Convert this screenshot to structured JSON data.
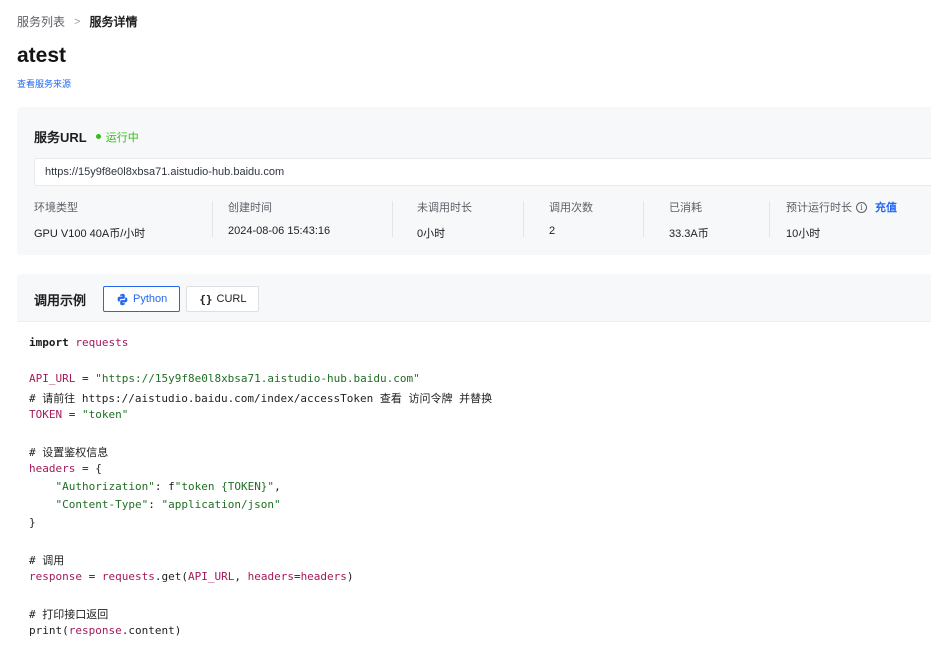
{
  "breadcrumb": {
    "parent": "服务列表",
    "separator": ">",
    "current": "服务详情"
  },
  "page": {
    "title": "atest",
    "source_link": "查看服务来源"
  },
  "service": {
    "title": "服务URL",
    "status": "运行中",
    "status_color": "#30bf13",
    "url": "https://15y9f8e0l8xbsa71.aistudio-hub.baidu.com",
    "stats": [
      {
        "label": "环境类型",
        "value": "GPU V100 40A币/小时"
      },
      {
        "label": "创建时间",
        "value": "2024-08-06 15:43:16"
      },
      {
        "label": "未调用时长",
        "value": "0小时"
      },
      {
        "label": "调用次数",
        "value": "2"
      },
      {
        "label": "已消耗",
        "value": "33.3A币"
      },
      {
        "label": "预计运行时长",
        "value": "10小时",
        "info_icon": "info-icon",
        "action": "充值"
      }
    ]
  },
  "example": {
    "title": "调用示例",
    "tabs": [
      {
        "label": "Python",
        "icon": "python-icon",
        "active": true
      },
      {
        "label": "CURL",
        "icon": "curly-braces-icon",
        "active": false
      }
    ],
    "code": {
      "l1_kw": "import",
      "l1_mod": "requests",
      "l2_var": "API_URL",
      "l2_eq": " = ",
      "l2_str": "\"https://15y9f8e0l8xbsa71.aistudio-hub.baidu.com\"",
      "l3": "# 请前往 https://aistudio.baidu.com/index/accessToken 查看 访问令牌 并替换",
      "l4_var": "TOKEN",
      "l4_eq": " = ",
      "l4_str": "\"token\"",
      "l5": "# 设置鉴权信息",
      "l6_var": "headers",
      "l6_rest": " = {",
      "l7_key": "    \"Authorization\"",
      "l7_mid": ": f",
      "l7_str": "\"token {TOKEN}\"",
      "l7_end": ",",
      "l8_key": "    \"Content-Type\"",
      "l8_mid": ": ",
      "l8_str": "\"application/json\"",
      "l9": "}",
      "l10": "# 调用",
      "l11_var": "response",
      "l11_eq": " = ",
      "l11_fn": "requests",
      "l11_rest": ".get(",
      "l11_a1": "API_URL",
      "l11_rest2": ", ",
      "l11_a2": "headers",
      "l11_rest3": "=",
      "l11_a3": "headers",
      "l11_end": ")",
      "l12": "# 打印接口返回",
      "l13_fn": "print(",
      "l13_var": "response",
      "l13_rest": ".content)"
    }
  },
  "colors": {
    "accent": "#2468f2",
    "panel_bg": "#f7f8fa",
    "string": "#1f6f24",
    "identifier": "#a31a5c"
  }
}
